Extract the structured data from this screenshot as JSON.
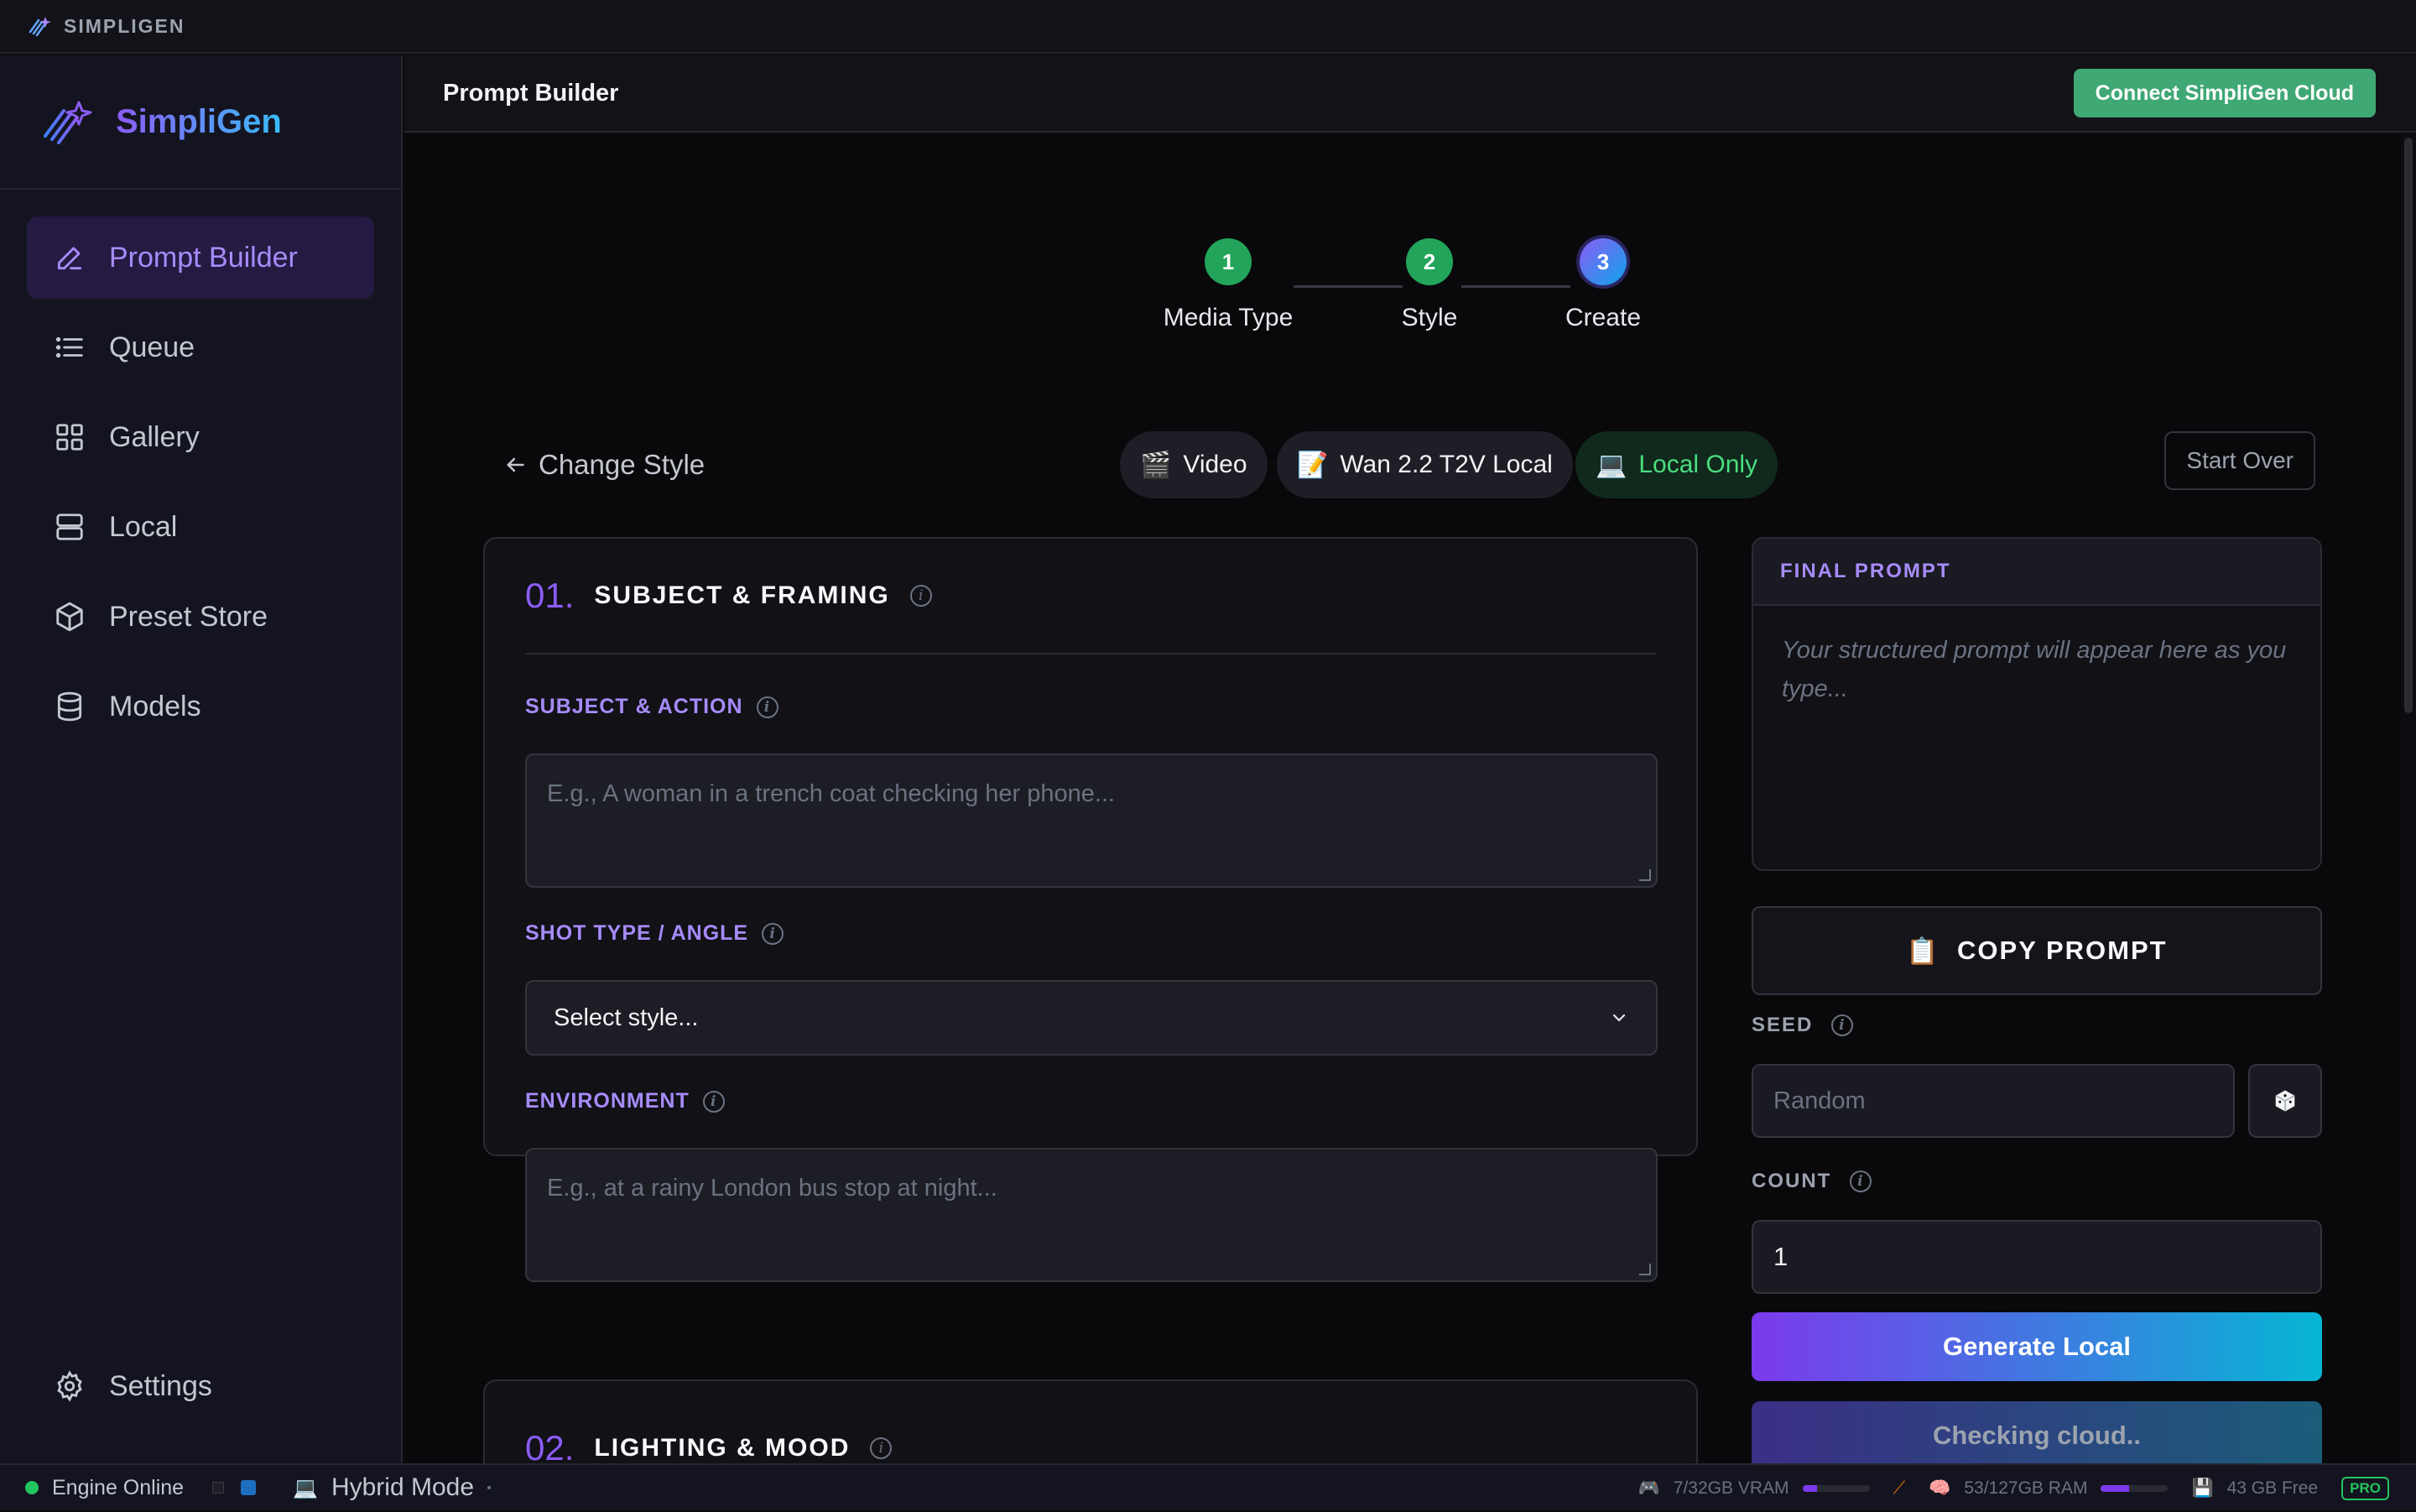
{
  "titlebar": {
    "app_name": "SIMPLIGEN"
  },
  "sidebar": {
    "brand": "SimpliGen",
    "items": [
      {
        "label": "Prompt Builder",
        "icon": "pencil-icon",
        "active": true
      },
      {
        "label": "Queue",
        "icon": "list-icon"
      },
      {
        "label": "Gallery",
        "icon": "grid-icon"
      },
      {
        "label": "Local",
        "icon": "server-icon"
      },
      {
        "label": "Preset Store",
        "icon": "box-icon"
      },
      {
        "label": "Models",
        "icon": "database-icon"
      }
    ],
    "settings_label": "Settings"
  },
  "topbar": {
    "title": "Prompt Builder",
    "connect_label": "Connect SimpliGen Cloud"
  },
  "stepper": {
    "steps": [
      {
        "number": "1",
        "label": "Media Type"
      },
      {
        "number": "2",
        "label": "Style"
      },
      {
        "number": "3",
        "label": "Create"
      }
    ]
  },
  "controls": {
    "change_style": "Change Style",
    "chips": [
      {
        "emoji": "🎬",
        "label": "Video"
      },
      {
        "emoji": "📝",
        "label": "Wan 2.2 T2V Local"
      },
      {
        "emoji": "💻",
        "label": "Local Only"
      }
    ],
    "start_over": "Start Over"
  },
  "section1": {
    "number": "01.",
    "title": "SUBJECT & FRAMING",
    "subject_label": "SUBJECT & ACTION",
    "subject_placeholder": "E.g., A woman in a trench coat checking her phone...",
    "shot_label": "SHOT TYPE / ANGLE",
    "shot_value": "Select style...",
    "environment_label": "ENVIRONMENT",
    "environment_placeholder": "E.g., at a rainy London bus stop at night..."
  },
  "section2": {
    "number": "02.",
    "title": "LIGHTING & MOOD"
  },
  "final_prompt": {
    "header": "FINAL PROMPT",
    "placeholder": "Your structured prompt will appear here as you type..."
  },
  "copy_label": "COPY PROMPT",
  "seed": {
    "label": "SEED",
    "placeholder": "Random"
  },
  "count": {
    "label": "COUNT",
    "value": "1"
  },
  "generate_label": "Generate Local",
  "checking_label": "Checking cloud..",
  "statusbar": {
    "engine": "Engine Online",
    "mode": "Hybrid Mode",
    "vram": "7/32GB VRAM",
    "vram_fraction": 0.22,
    "ram": "53/127GB RAM",
    "ram_fraction": 0.42,
    "disk": "43 GB Free",
    "badge": "PRO"
  },
  "colors": {
    "accent": "#8b5cf6",
    "success": "#22c55e",
    "cloud_button": "#3fa874"
  }
}
